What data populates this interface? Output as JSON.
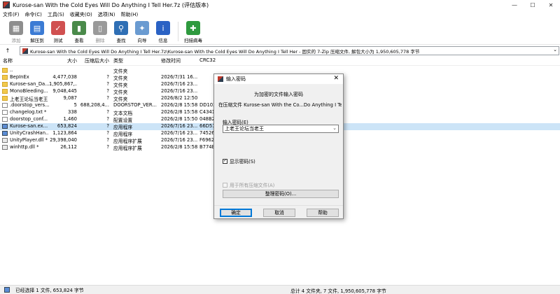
{
  "window": {
    "title": "Kurose-san With the Cold Eyes Will Do Anything I Tell Her.7z (评估版本)",
    "minimize": "—",
    "maximize": "☐",
    "close": "✕"
  },
  "menu": [
    "文件(F)",
    "命令(C)",
    "工具(S)",
    "收藏夹(O)",
    "选项(N)",
    "帮助(H)"
  ],
  "toolbar": [
    {
      "label": "添加",
      "icon": "add-icon",
      "enabled": false,
      "color": "#8e8e8e",
      "glyph": "▦"
    },
    {
      "label": "解压到",
      "icon": "extract-icon",
      "enabled": true,
      "color": "#3b7bd4",
      "glyph": "▤"
    },
    {
      "label": "测试",
      "icon": "test-icon",
      "enabled": true,
      "color": "#d05050",
      "glyph": "✓"
    },
    {
      "label": "查看",
      "icon": "view-icon",
      "enabled": true,
      "color": "#4a8a4a",
      "glyph": "▮"
    },
    {
      "label": "删除",
      "icon": "delete-icon",
      "enabled": false,
      "color": "#9a9a9a",
      "glyph": "▯"
    },
    {
      "label": "查找",
      "icon": "find-icon",
      "enabled": true,
      "color": "#2f6fb5",
      "glyph": "⚲"
    },
    {
      "label": "向导",
      "icon": "wizard-icon",
      "enabled": true,
      "color": "#6a9bd1",
      "glyph": "✦"
    },
    {
      "label": "信息",
      "icon": "info-icon",
      "enabled": true,
      "color": "#2a62c4",
      "glyph": "i"
    },
    {
      "label": "扫描病毒",
      "icon": "virus-scan-icon",
      "enabled": true,
      "color": "#2e9a3e",
      "glyph": "✚"
    }
  ],
  "address": {
    "up": "↑",
    "path": "Kurose-san With the Cold Eyes Will Do Anything I Tell Her.7z\\Kurose-san With the Cold Eyes Will Do Anything I Tell Her - 固实的 7-Zip 压缩文件, 解包大小为 1,950,605,778 字节",
    "dropdown": "⌄"
  },
  "columns": {
    "name": "名称",
    "size": "大小",
    "packed": "压缩后大小",
    "type": "类型",
    "modified": "修改时间",
    "crc": "CRC32"
  },
  "files": [
    {
      "name": "..",
      "size": "",
      "packed": "",
      "type": "文件夹",
      "modified": "",
      "crc": "",
      "kind": "folder"
    },
    {
      "name": "BepInEx",
      "size": "4,477,038",
      "packed": "?",
      "type": "文件夹",
      "modified": "2026/7/31 16...",
      "crc": "",
      "kind": "folder"
    },
    {
      "name": "Kurose-san_Da...",
      "size": "1,905,867,...",
      "packed": "?",
      "type": "文件夹",
      "modified": "2026/7/16 23...",
      "crc": "",
      "kind": "folder"
    },
    {
      "name": "MonoBleeding...",
      "size": "9,048,445",
      "packed": "?",
      "type": "文件夹",
      "modified": "2026/7/16 23...",
      "crc": "",
      "kind": "folder"
    },
    {
      "name": "上老王论坛当老王",
      "size": "9,087",
      "packed": "?",
      "type": "文件夹",
      "modified": "2026/8/2 12:50",
      "crc": "",
      "kind": "folder"
    },
    {
      "name": ".doorstop_vers...",
      "size": "5",
      "packed": "688,208,4...",
      "type": "DOORSTOP_VER...",
      "modified": "2026/2/8 15:58",
      "crc": "DD102",
      "kind": "file"
    },
    {
      "name": "changelog.txt *",
      "size": "338",
      "packed": "?",
      "type": "文本文档",
      "modified": "2026/2/8 15:58",
      "crc": "C4341",
      "kind": "file"
    },
    {
      "name": "doorstop_conf...",
      "size": "1,460",
      "packed": "?",
      "type": "配置设置",
      "modified": "2026/2/8 15:50",
      "crc": "048B2",
      "kind": "file"
    },
    {
      "name": "Kurose-san.ex...",
      "size": "653,824",
      "packed": "?",
      "type": "应用程序",
      "modified": "2026/7/16 23...",
      "crc": "66D51",
      "kind": "exe",
      "selected": true
    },
    {
      "name": "UnityCrashHan...",
      "size": "1,123,864",
      "packed": "?",
      "type": "应用程序",
      "modified": "2026/7/16 23...",
      "crc": "74526",
      "kind": "exe"
    },
    {
      "name": "UnityPlayer.dll *",
      "size": "29,398,040",
      "packed": "?",
      "type": "应用程序扩展",
      "modified": "2026/7/16 23...",
      "crc": "F6962",
      "kind": "dll"
    },
    {
      "name": "winhttp.dll *",
      "size": "26,112",
      "packed": "?",
      "type": "应用程序扩展",
      "modified": "2026/2/8 15:58",
      "crc": "B774B",
      "kind": "dll"
    }
  ],
  "status": {
    "left": "已经选择 1 文件, 653,824 字节",
    "right": "总计 4 文件夹, 7 文件, 1,950,605,778 字节"
  },
  "dialog": {
    "title": "输入密码",
    "close": "✕",
    "heading": "为加密的文件输入密码",
    "file_line": "在压缩文件 Kurose-san With the Co...Do Anything I Tell Her.7z 里",
    "password_label": "输入密码(E)",
    "password_value": "上老王论坛当老王",
    "show_password_label": "显示密码(S)",
    "show_password_checked": true,
    "all_archives_label": "用于所有压缩文件(A)",
    "manage_label": "整理密码(O)...",
    "ok_label": "确定",
    "cancel_label": "取消",
    "help_label": "帮助"
  }
}
